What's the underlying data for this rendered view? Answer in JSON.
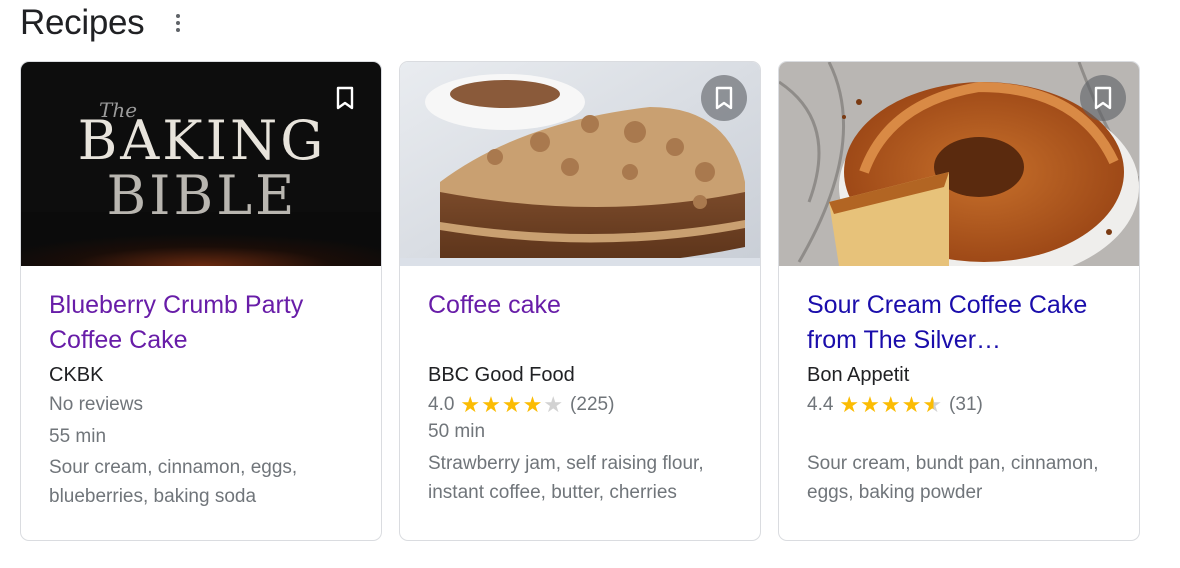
{
  "header": {
    "title": "Recipes"
  },
  "cards": [
    {
      "image_title_small": "The",
      "image_title_line1": "BAKING",
      "image_title_line2": "BIBLE",
      "title": "Blueberry Crumb Party Coffee Cake",
      "source": "CKBK",
      "reviews": "No reviews",
      "time": "55 min",
      "ingredients": "Sour cream, cinnamon, eggs, blueberries, baking soda"
    },
    {
      "title": "Coffee cake",
      "source": "BBC Good Food",
      "rating": "4.0",
      "stars_full": 4,
      "count": "(225)",
      "time": "50 min",
      "ingredients": "Strawberry jam, self raising flour, instant coffee, butter, cherries"
    },
    {
      "title": "Sour Cream Coffee Cake from The Silver…",
      "source": "Bon Appetit",
      "rating": "4.4",
      "stars_full": 4.5,
      "count": "(31)",
      "ingredients": "Sour cream, bundt pan, cinnamon, eggs, baking powder"
    }
  ],
  "colors": {
    "visited_link": "#681da8",
    "unvisited_link": "#1a0dab",
    "star": "#fbbc04",
    "secondary_text": "#70757a"
  },
  "icons": [
    "more-vert-icon",
    "bookmark-icon",
    "star-icon"
  ]
}
